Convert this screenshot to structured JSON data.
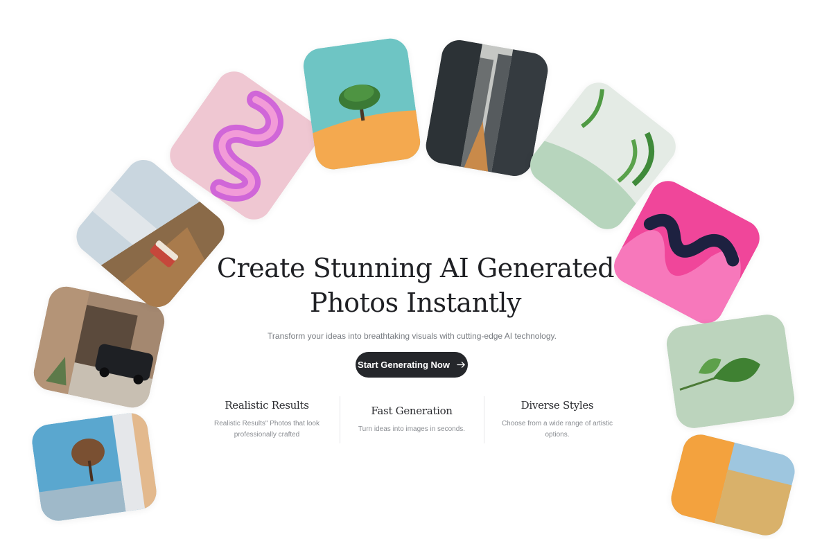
{
  "hero": {
    "title_line1": "Create Stunning AI Generated",
    "title_line2": "Photos Instantly",
    "subtitle": "Transform your ideas into breathtaking visuals with cutting-edge AI technology.",
    "cta_label": "Start Generating Now"
  },
  "features": [
    {
      "title": "Realistic Results",
      "description": "Realistic Results\" Photos that look professionally crafted"
    },
    {
      "title": "Fast Generation",
      "description": "Turn ideas into images in seconds."
    },
    {
      "title": "Diverse Styles",
      "description": "Choose from a wide range of artistic options."
    }
  ],
  "colors": {
    "cta_background": "#25272b",
    "title_text": "#1f2024",
    "muted_text": "#777b80"
  }
}
